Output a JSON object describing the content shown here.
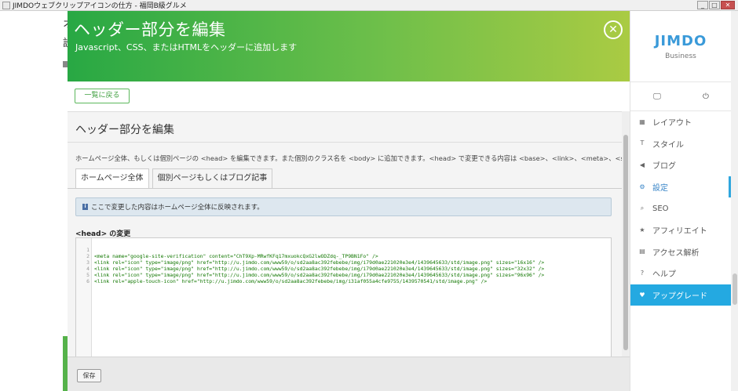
{
  "window": {
    "title": "JIMDOウェブクリップアイコンの仕方 - 福岡B級グルメ",
    "minimize": "_",
    "maximize": "□",
    "close": "✕"
  },
  "bgpage": {
    "text1": "オ",
    "text2": "設"
  },
  "modal": {
    "title": "ヘッダー部分を編集",
    "subtitle": "Javascript、CSS、またはHTMLをヘッダーに追加します",
    "close_glyph": "✕",
    "back_label": "一覧に戻る",
    "section_title": "ヘッダー部分を編集",
    "description": "ホームページ全体、もしくは個別ページの <head> を編集できます。また個別のクラス名を <body> に追加できます。<head> で変更できる内容は <base>、<link>、<meta>、<style>、<script> です。",
    "tabs": [
      {
        "label": "ホームページ全体"
      },
      {
        "label": "個別ページもしくはブログ記事"
      }
    ],
    "info_icon": "i",
    "info_text": "ここで変更した内容はホームページ全体に反映されます。",
    "head_label": "<head> の変更",
    "code_lines": [
      {
        "n": "1",
        "text": "<meta name=\"google-site-verification\" content=\"ChT9Xp-MRwfKFq17mxuokcQxG2lwODZdq-_TP9BN1Fo\" />"
      },
      {
        "n": "2",
        "text": "<link rel=\"icon\" type=\"image/png\" href=\"http://u.jimdo.com/www59/o/sd2aa8ac392febebe/img/i79d0ae221020e3e4/1439645633/std/image.png\" sizes=\"16x16\" />"
      },
      {
        "n": "3",
        "text": "<link rel=\"icon\" type=\"image/png\" href=\"http://u.jimdo.com/www59/o/sd2aa8ac392febebe/img/i79d0ae221020e3e4/1439645633/std/image.png\" sizes=\"32x32\" />"
      },
      {
        "n": "4",
        "text": "<link rel=\"icon\" type=\"image/png\" href=\"http://u.jimdo.com/www59/o/sd2aa8ac392febebe/img/i79d0ae221020e3e4/1439645633/std/image.png\" sizes=\"96x96\" />"
      },
      {
        "n": "5",
        "text": "<link rel=\"apple-touch-icon\" href=\"http://u.jimdo.com/www59/o/sd2aa8ac392febebe/img/i31af055a4cfe9755/1439570541/std/image.png\" />"
      },
      {
        "n": "6",
        "text": ""
      }
    ],
    "save_label": "保存"
  },
  "sidebar": {
    "logo": "JIMDO",
    "plan": "Business",
    "desktop_icon": "🖵",
    "power_icon": "⏻",
    "items": [
      {
        "label": "レイアウト",
        "icon": "▦"
      },
      {
        "label": "スタイル",
        "icon": "T"
      },
      {
        "label": "ブログ",
        "icon": "◀"
      },
      {
        "label": "設定",
        "icon": "⚙"
      },
      {
        "label": "SEO",
        "icon": "⌕"
      },
      {
        "label": "アフィリエイト",
        "icon": "★"
      },
      {
        "label": "アクセス解析",
        "icon": "▤"
      },
      {
        "label": "ヘルプ",
        "icon": "?"
      },
      {
        "label": "アップグレード",
        "icon": "♥"
      }
    ]
  },
  "colors": {
    "header_start": "#28a844",
    "header_end": "#aacb43",
    "accent": "#24a9e1",
    "active": "#3a86c8"
  }
}
